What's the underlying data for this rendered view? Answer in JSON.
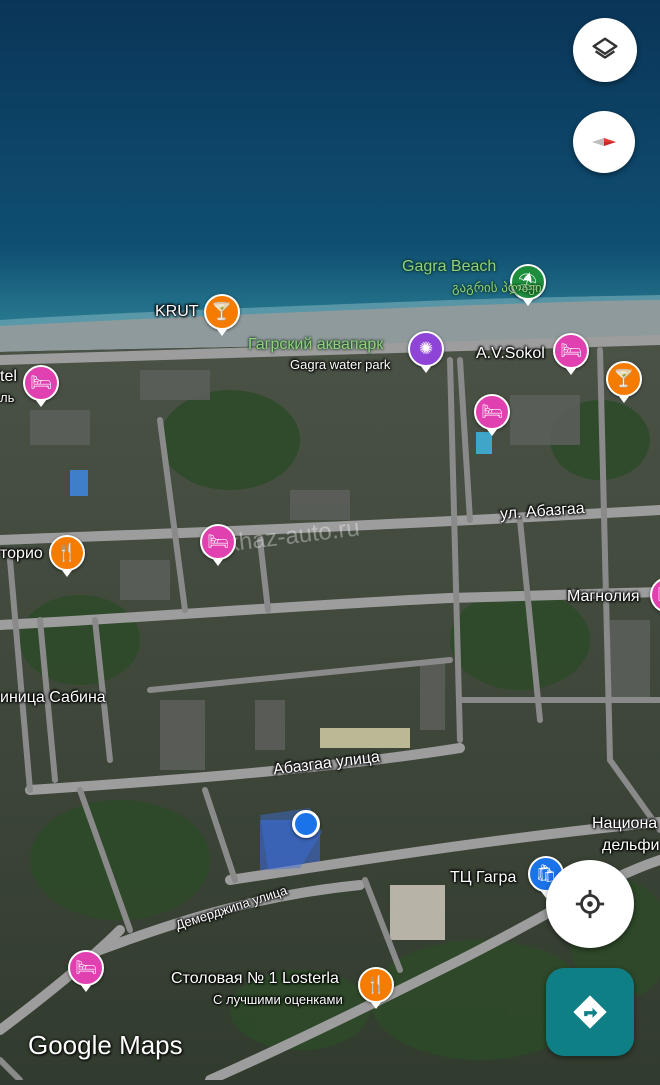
{
  "map": {
    "attribution": "Google Maps",
    "watermark": "abkhaz-auto.ru"
  },
  "controls": {
    "layers_icon": "layers-icon",
    "compass_icon": "compass-icon",
    "my_location_icon": "crosshair-icon",
    "directions_icon": "directions-icon"
  },
  "places": {
    "gagra_beach": {
      "label": "Gagra Beach",
      "sublabel": "გაგრის პლაჟი",
      "icon": "beach-umbrella-icon",
      "color": "#1e8e3e"
    },
    "krut": {
      "label": "KRUT",
      "icon": "cocktail-icon",
      "color": "#f57c00"
    },
    "aquapark": {
      "label": "Гагрский аквапарк",
      "sublabel": "Gagra water park",
      "icon": "ferris-wheel-icon",
      "color": "#8e44d6"
    },
    "av_sokol": {
      "label": "A.V.Sokol",
      "icon": "bed-icon",
      "color": "#e040b0"
    },
    "bar_right": {
      "icon": "cocktail-icon",
      "color": "#f57c00"
    },
    "hotel_left": {
      "label": "tel",
      "sublabel": "ль",
      "icon": "bed-icon",
      "color": "#e040b0"
    },
    "hotel_mid": {
      "icon": "bed-icon",
      "color": "#e040b0"
    },
    "hotel_center": {
      "icon": "bed-icon",
      "color": "#e040b0"
    },
    "sanatorio": {
      "label": "торио",
      "icon": "restaurant-icon",
      "color": "#f57c00"
    },
    "magnolia": {
      "label": "Магнолия",
      "icon": "bed-icon",
      "color": "#e040b0"
    },
    "sabina": {
      "label": "иница Сабина"
    },
    "tc_gagra": {
      "label": "ТЦ Гагра",
      "icon": "shopping-bag-icon",
      "color": "#1a73e8"
    },
    "national": {
      "label": "Национа",
      "sublabel": "дельфи"
    },
    "stolovaya": {
      "label": "Столовая № 1 Losterla",
      "sublabel": "С лучшими оценками",
      "icon": "restaurant-icon",
      "color": "#f57c00"
    },
    "hotel_bottom": {
      "icon": "bed-icon",
      "color": "#e040b0"
    }
  },
  "streets": {
    "abazgaa_ul": "ул. Абазгаа",
    "abazgaa_street": "Абазгаа улица",
    "demerdzhipa": "Демерджипа улица"
  },
  "colors": {
    "sea_deep": "#0c3f63",
    "sea_shallow": "#1f6f8f",
    "beach": "#8f9a9c",
    "land": "#3d4a3a",
    "road": "#9d9d9d",
    "location_dot": "#1a73e8"
  }
}
